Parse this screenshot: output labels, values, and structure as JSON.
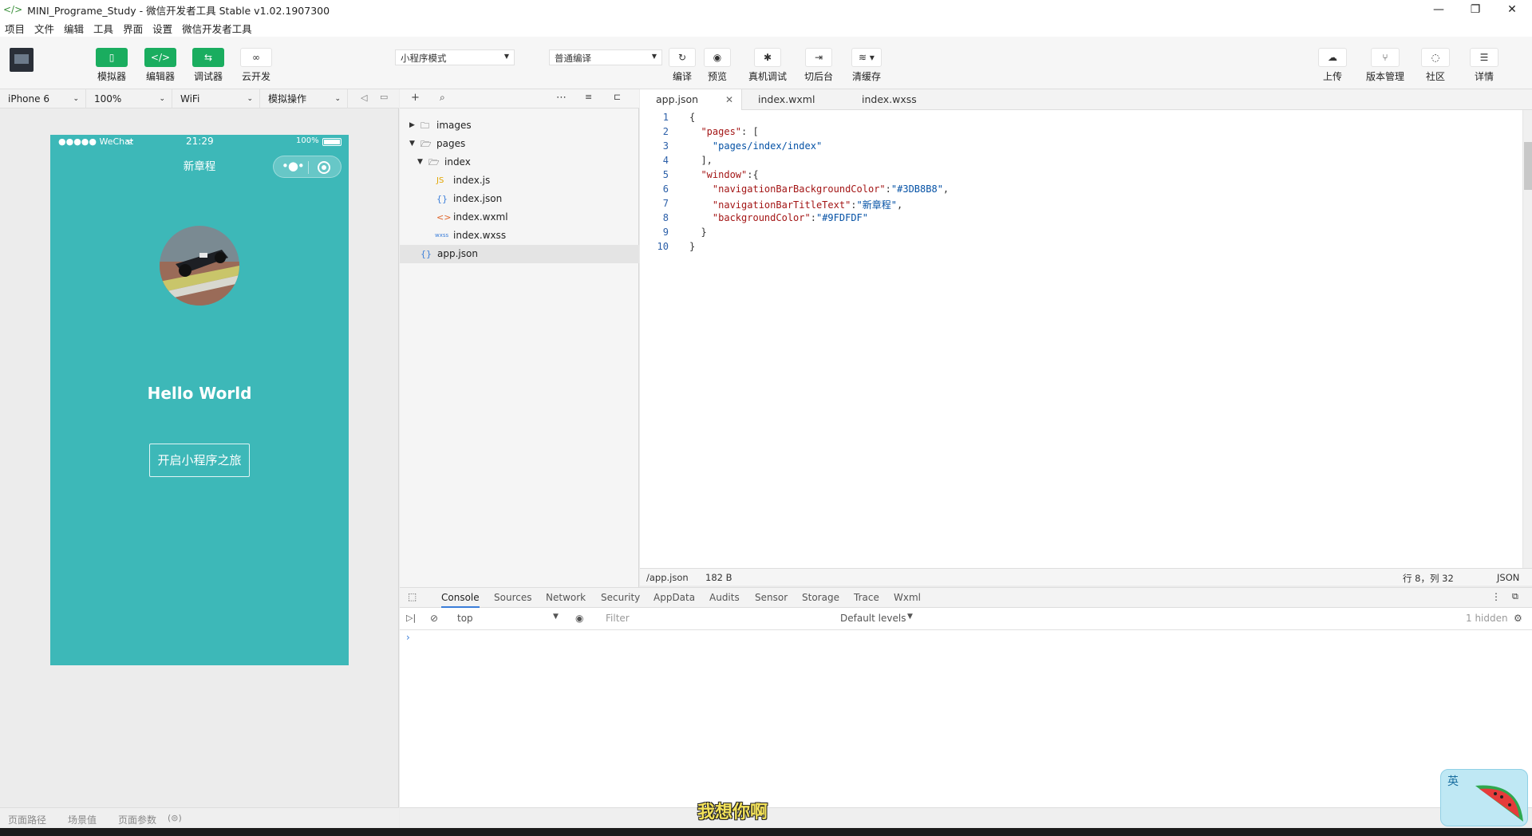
{
  "window": {
    "title": "MINI_Programe_Study - 微信开发者工具 Stable v1.02.1907300",
    "controls": [
      "minimize-icon",
      "restore-icon",
      "close-icon"
    ]
  },
  "menubar": [
    "项目",
    "文件",
    "编辑",
    "工具",
    "界面",
    "设置",
    "微信开发者工具"
  ],
  "toolbar": {
    "left_buttons": [
      {
        "label": "模拟器",
        "icon": "phone-icon"
      },
      {
        "label": "编辑器",
        "icon": "code-icon"
      },
      {
        "label": "调试器",
        "icon": "swap-icon"
      },
      {
        "label": "云开发",
        "icon": "cloud-link-icon"
      }
    ],
    "mode_select": "小程序模式",
    "compile_select": "普通编译",
    "center_buttons": [
      {
        "label": "编译",
        "icon": "refresh-icon"
      },
      {
        "label": "预览",
        "icon": "eye-icon"
      },
      {
        "label": "真机调试",
        "icon": "bug-icon"
      },
      {
        "label": "切后台",
        "icon": "switch-icon"
      },
      {
        "label": "清缓存",
        "icon": "layers-icon"
      }
    ],
    "right_buttons": [
      {
        "label": "上传",
        "icon": "upload-icon"
      },
      {
        "label": "版本管理",
        "icon": "branch-icon"
      },
      {
        "label": "社区",
        "icon": "chat-icon"
      },
      {
        "label": "详情",
        "icon": "menu-icon"
      }
    ]
  },
  "simulator": {
    "device": "iPhone 6",
    "zoom": "100%",
    "network": "WiFi",
    "ops": "模拟操作",
    "statusbar": {
      "carrier": "●●●●● WeChat",
      "time": "21:29",
      "battery": "100%"
    },
    "nav_title": "新章程",
    "nav_bg": "#3DB8B8",
    "hello_text": "Hello World",
    "start_button": "开启小程序之旅",
    "footer": [
      "页面路径",
      "场景值",
      "页面参数"
    ]
  },
  "filetree": {
    "items": [
      {
        "name": "images",
        "type": "folder",
        "expanded": false
      },
      {
        "name": "pages",
        "type": "folder",
        "expanded": true
      },
      {
        "name": "index",
        "type": "folder",
        "expanded": true
      },
      {
        "name": "index.js",
        "type": "js"
      },
      {
        "name": "index.json",
        "type": "json"
      },
      {
        "name": "index.wxml",
        "type": "wxml"
      },
      {
        "name": "index.wxss",
        "type": "wxss"
      },
      {
        "name": "app.json",
        "type": "json",
        "selected": true
      }
    ]
  },
  "editor": {
    "tabs": [
      "app.json",
      "index.wxml",
      "index.wxss"
    ],
    "active_tab": "app.json",
    "lines": [
      "{",
      "  \"pages\": [",
      "    \"pages/index/index\"",
      "  ],",
      "  \"window\":{",
      "    \"navigationBarBackgroundColor\":\"#3DB8B8\",",
      "    \"navigationBarTitleText\":\"新章程\",",
      "    \"backgroundColor\":\"#9FDFDF\"",
      "  }",
      "}"
    ],
    "status": {
      "path": "/app.json",
      "size": "182 B",
      "cursor": "行 8，列 32",
      "lang": "JSON"
    }
  },
  "devtools": {
    "tabs": [
      "Console",
      "Sources",
      "Network",
      "Security",
      "AppData",
      "Audits",
      "Sensor",
      "Storage",
      "Trace",
      "Wxml"
    ],
    "active_tab": "Console",
    "context": "top",
    "filter_placeholder": "Filter",
    "levels": "Default levels",
    "hidden": "1 hidden"
  },
  "overlay": {
    "subtitle": "我想你啊",
    "ime_label": "英"
  }
}
